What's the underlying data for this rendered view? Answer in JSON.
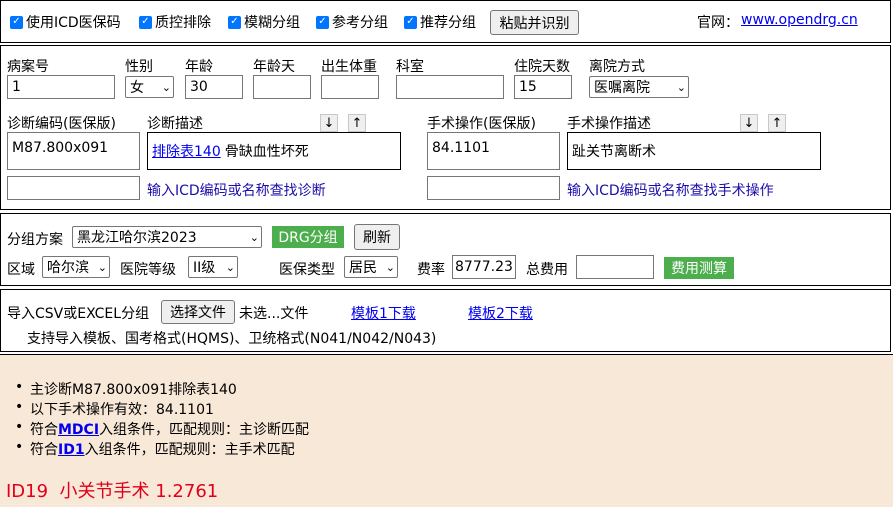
{
  "top": {
    "checkboxes": [
      "使用ICD医保码",
      "质控排除",
      "模糊分组",
      "参考分组",
      "推荐分组"
    ],
    "paste_button": "粘贴并识别",
    "site_label": "官网：",
    "site_link": "www.opendrg.cn"
  },
  "patient": {
    "labels": {
      "case_no": "病案号",
      "sex": "性别",
      "age": "年龄",
      "age_days": "年龄天",
      "birth_weight": "出生体重",
      "dept": "科室",
      "los": "住院天数",
      "discharge": "离院方式"
    },
    "values": {
      "case_no": "1",
      "sex": "女",
      "age": "30",
      "age_days": "",
      "birth_weight": "",
      "dept": "",
      "los": "15",
      "discharge": "医嘱离院"
    }
  },
  "diagnosis": {
    "code_label": "诊断编码(医保版)",
    "desc_label": "诊断描述",
    "code": "M87.800x091",
    "exclusion_link": "排除表140",
    "desc": "骨缺血性坏死",
    "search_link": "输入ICD编码或名称查找诊断",
    "up": "↑",
    "down": "↓"
  },
  "surgery": {
    "code_label": "手术操作(医保版)",
    "desc_label": "手术操作描述",
    "code": "84.1101",
    "desc": "趾关节离断术",
    "search_link": "输入ICD编码或名称查找手术操作",
    "up": "↑",
    "down": "↓"
  },
  "grouping": {
    "scheme_label": "分组方案",
    "scheme": "黑龙江哈尔滨2023",
    "drg_button": "DRG分组",
    "refresh_button": "刷新",
    "region_label": "区域",
    "region": "哈尔滨",
    "hospital_level_label": "医院等级",
    "hospital_level": "II级",
    "insurance_label": "医保类型",
    "insurance": "居民",
    "rate_label": "费率",
    "rate": "8777.23",
    "total_label": "总费用",
    "total": "",
    "calc_button": "费用测算"
  },
  "import": {
    "label": "导入CSV或EXCEL分组",
    "choose_button": "选择文件",
    "no_file": "未选...文件",
    "template1": "模板1下载",
    "template2": "模板2下载",
    "support_text": "支持导入模板、国考格式(HQMS)、卫统格式(N041/N042/N043)"
  },
  "result": {
    "line1": "主诊断M87.800x091排除表140",
    "line2": "以下手术操作有效：84.1101",
    "line3_pre": "符合",
    "line3_link": "MDCI",
    "line3_post": "入组条件，匹配规则：主诊断匹配",
    "line4_pre": "符合",
    "line4_link": "ID1",
    "line4_post": "入组条件，匹配规则：主手术匹配",
    "drg": "ID19  小关节手术 1.2761"
  },
  "colors": {
    "accent_blue": "#0075ff",
    "green": "#4cae4c",
    "result_bg": "#f8e8d8",
    "drg_red": "#e0001b"
  }
}
